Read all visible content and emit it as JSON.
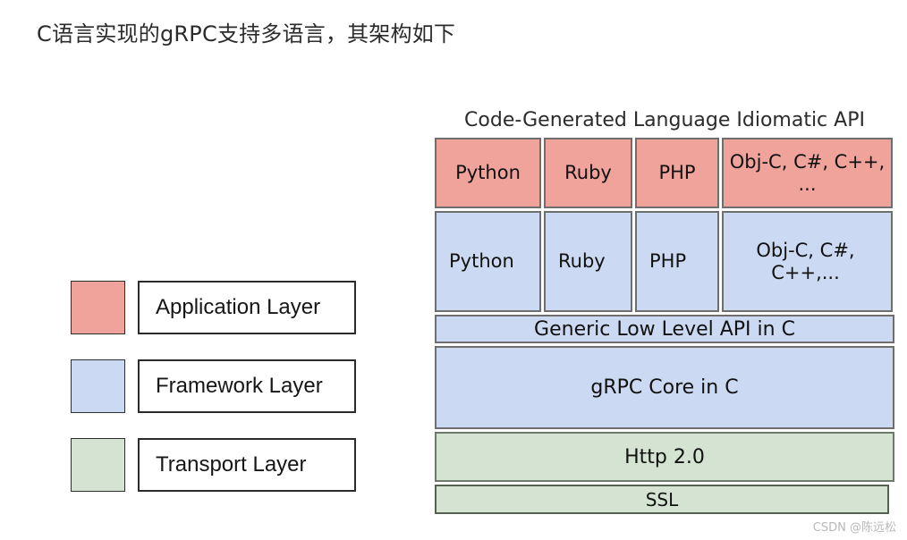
{
  "page": {
    "title": "C语言实现的gRPC支持多语言，其架构如下",
    "watermark": "CSDN @陈远松",
    "background_color": "#ffffff"
  },
  "colors": {
    "application_layer": "#f0a39b",
    "framework_layer": "#cbdaf2",
    "transport_layer": "#d5e4d2",
    "cell_border": "#6e6e6e",
    "legend_border": "#2b2b2b"
  },
  "legend": {
    "items": [
      {
        "label": "Application Layer",
        "color": "#f0a39b",
        "swatch_name": "application-layer-swatch"
      },
      {
        "label": "Framework Layer",
        "color": "#cbdaf2",
        "swatch_name": "framework-layer-swatch"
      },
      {
        "label": "Transport Layer",
        "color": "#d5e4d2",
        "swatch_name": "transport-layer-swatch"
      }
    ]
  },
  "architecture": {
    "caption": "Code-Generated Language Idiomatic API",
    "application_row": [
      {
        "label": "Python"
      },
      {
        "label": "Ruby"
      },
      {
        "label": "PHP"
      },
      {
        "label": "Obj-C, C#, C++, ..."
      }
    ],
    "framework_row": [
      {
        "label": "Python"
      },
      {
        "label": "Ruby"
      },
      {
        "label": "PHP"
      },
      {
        "label": "Obj-C, C#, C++,..."
      }
    ],
    "bands": [
      {
        "label": "Generic Low Level API in C",
        "layer": "framework"
      },
      {
        "label": "gRPC Core in C",
        "layer": "framework"
      },
      {
        "label": "Http 2.0",
        "layer": "transport"
      },
      {
        "label": "SSL",
        "layer": "transport"
      }
    ]
  }
}
